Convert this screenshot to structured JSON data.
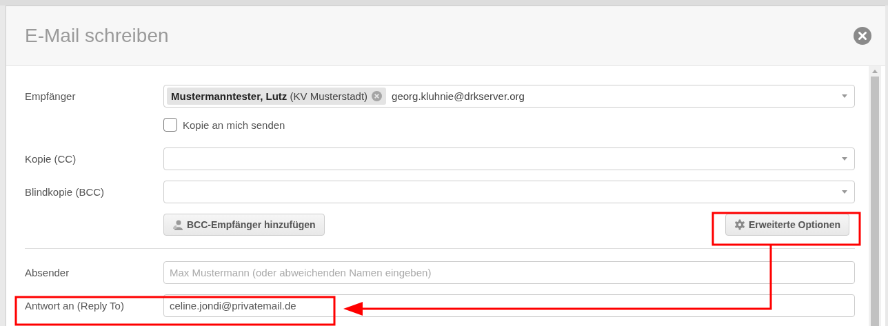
{
  "dialog": {
    "title": "E-Mail schreiben"
  },
  "fields": [
    {
      "kind": "tags",
      "label": "Empfänger",
      "chips": [
        {
          "name": "Mustermanntester, Lutz",
          "org": "(KV Musterstadt)"
        }
      ],
      "value": "georg.kluhnie@drkserver.org"
    },
    {
      "kind": "checkbox",
      "label": "Kopie an mich senden",
      "checked": false
    },
    {
      "kind": "select",
      "label": "Kopie (CC)"
    },
    {
      "kind": "select",
      "label": "Blindkopie (BCC)"
    },
    {
      "kind": "buttons",
      "left": "BCC-Empfänger hinzufügen",
      "right": "Erweiterte Optionen"
    },
    {
      "kind": "divider"
    },
    {
      "kind": "text",
      "label": "Absender",
      "placeholder": "Max Mustermann (oder abweichenden Namen eingeben)"
    },
    {
      "kind": "text",
      "label": "Antwort an (Reply To)",
      "value": "celine.jondi@privatemail.de"
    }
  ]
}
